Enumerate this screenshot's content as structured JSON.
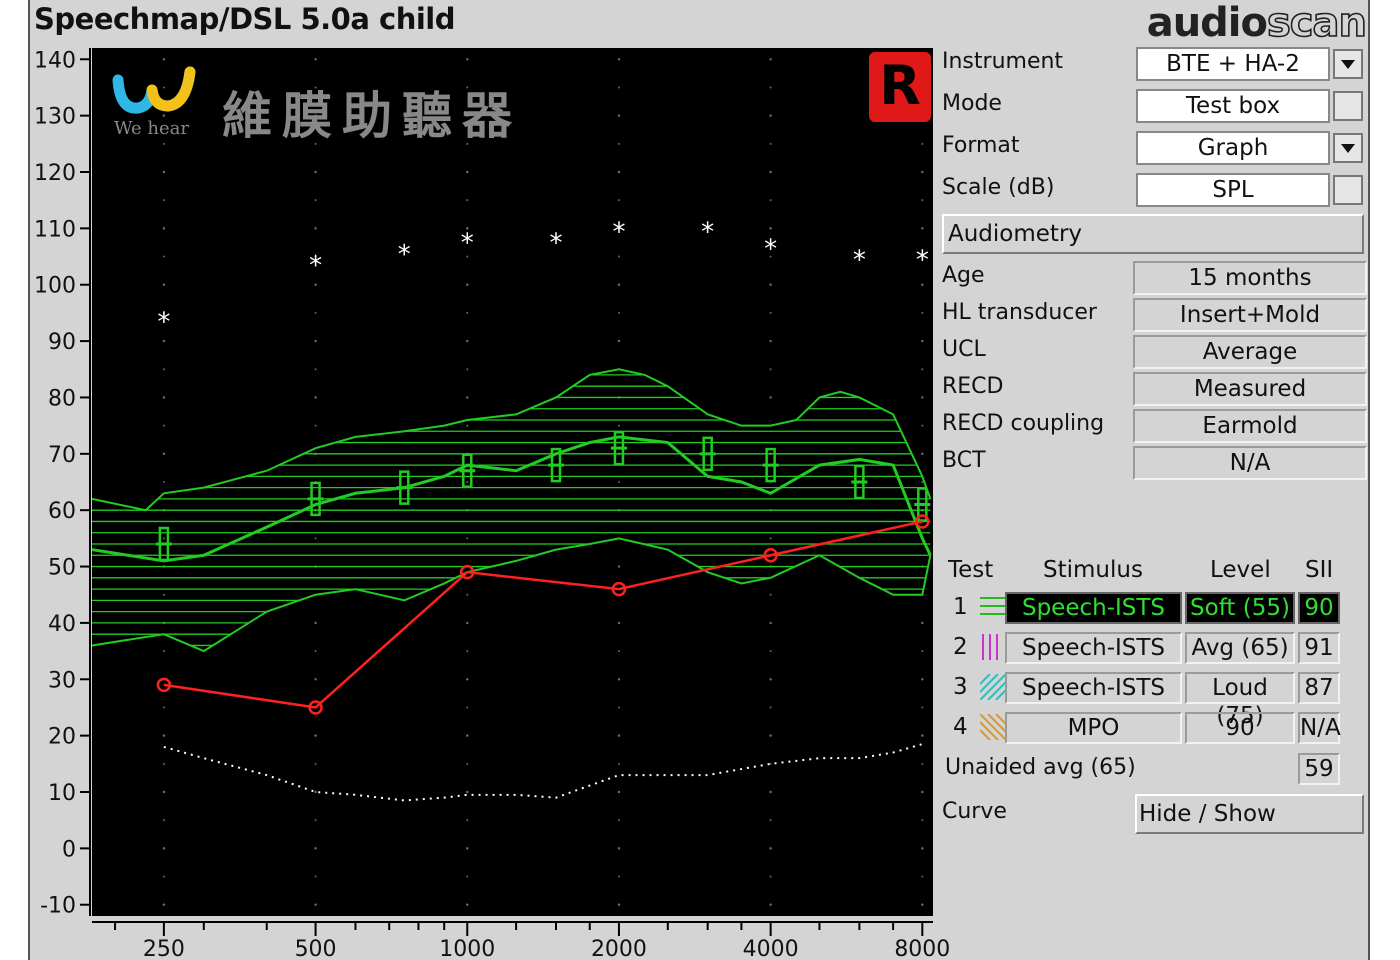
{
  "app": {
    "title": "Speechmap/DSL 5.0a child",
    "brand_left": "audio",
    "brand_right": "scan"
  },
  "ear_badge": "R",
  "watermark": {
    "latin": "We hear",
    "chinese": "維膜助聽器"
  },
  "settings": [
    {
      "label": "Instrument",
      "value": "BTE + HA-2",
      "control": "dropdown"
    },
    {
      "label": "Mode",
      "value": "Test box",
      "control": "checkbox"
    },
    {
      "label": "Format",
      "value": "Graph",
      "control": "dropdown"
    },
    {
      "label": "Scale (dB)",
      "value": "SPL",
      "control": "checkbox"
    }
  ],
  "audiometry_button": "Audiometry",
  "audiometry": [
    {
      "label": "Age",
      "value": "15 months"
    },
    {
      "label": "HL transducer",
      "value": "Insert+Mold"
    },
    {
      "label": "UCL",
      "value": "Average"
    },
    {
      "label": "RECD",
      "value": "Measured"
    },
    {
      "label": "RECD coupling",
      "value": "Earmold"
    },
    {
      "label": "BCT",
      "value": "N/A"
    }
  ],
  "tests_table": {
    "headers": {
      "test": "Test",
      "stimulus": "Stimulus",
      "level": "Level",
      "sii": "SII"
    },
    "rows": [
      {
        "num": "1",
        "stimulus": "Speech-ISTS",
        "level": "Soft (55)",
        "sii": "90",
        "swatch_color": "#22bb22",
        "swatch": "horizontal-lines",
        "active": true
      },
      {
        "num": "2",
        "stimulus": "Speech-ISTS",
        "level": "Avg (65)",
        "sii": "91",
        "swatch_color": "#cc33cc",
        "swatch": "vertical-lines",
        "active": false
      },
      {
        "num": "3",
        "stimulus": "Speech-ISTS",
        "level": "Loud (75)",
        "sii": "87",
        "swatch_color": "#33bbbb",
        "swatch": "diagonal-lines",
        "active": false
      },
      {
        "num": "4",
        "stimulus": "MPO",
        "level": "90",
        "sii": "N/A",
        "swatch_color": "#dd9922",
        "swatch": "diagonal-lines",
        "active": false
      }
    ],
    "unaided": {
      "label": "Unaided avg (65)",
      "value": "59"
    }
  },
  "curve": {
    "label": "Curve",
    "button": "Hide / Show"
  },
  "chart_data": {
    "type": "line",
    "title": "",
    "xlabel": "",
    "ylabel": "",
    "x_scale": "log",
    "xlim": [
      180,
      8400
    ],
    "ylim": [
      -12,
      142
    ],
    "x_ticks": [
      250,
      500,
      1000,
      2000,
      4000,
      8000
    ],
    "y_ticks": [
      140,
      130,
      120,
      110,
      100,
      90,
      80,
      70,
      60,
      50,
      40,
      30,
      20,
      10,
      0,
      -10
    ],
    "grid": "dotted",
    "series": [
      {
        "style": "ucl-asterisks",
        "color": "#ffffff",
        "x": [
          250,
          500,
          750,
          1000,
          1500,
          2000,
          3000,
          4000,
          6000,
          8000
        ],
        "y": [
          94,
          104,
          106,
          108,
          108,
          110,
          110,
          107,
          105,
          105
        ]
      },
      {
        "style": "threshold-circles",
        "color": "#ff2020",
        "x": [
          250,
          500,
          1000,
          2000,
          4000,
          8000
        ],
        "y": [
          29,
          25,
          49,
          46,
          52,
          58
        ]
      },
      {
        "style": "speech-ltass",
        "color": "#22cc22",
        "x": [
          180,
          250,
          300,
          400,
          500,
          600,
          750,
          900,
          1000,
          1250,
          1500,
          1750,
          2000,
          2500,
          3000,
          3500,
          4000,
          5000,
          6000,
          7000,
          8000,
          8300
        ],
        "y": [
          53,
          51,
          52,
          57,
          61,
          63,
          64,
          66,
          68,
          67,
          70,
          72,
          73,
          72,
          66,
          65,
          63,
          68,
          69,
          68,
          55,
          52
        ]
      },
      {
        "style": "speech-band-upper",
        "color": "#22cc22",
        "x": [
          180,
          230,
          250,
          300,
          400,
          500,
          600,
          750,
          900,
          1000,
          1250,
          1500,
          1750,
          2000,
          2250,
          2500,
          3000,
          3500,
          4000,
          4500,
          5000,
          5500,
          6000,
          7000,
          8000,
          8300
        ],
        "y": [
          62,
          60,
          63,
          64,
          67,
          71,
          73,
          74,
          75,
          76,
          77,
          80,
          84,
          85,
          84,
          82,
          77,
          75,
          75,
          76,
          80,
          81,
          80,
          77,
          66,
          62
        ]
      },
      {
        "style": "speech-band-lower",
        "color": "#22cc22",
        "x": [
          180,
          250,
          300,
          400,
          500,
          600,
          750,
          900,
          1000,
          1250,
          1500,
          1750,
          2000,
          2500,
          3000,
          3500,
          4000,
          5000,
          6000,
          7000,
          8000,
          8300
        ],
        "y": [
          36,
          38,
          35,
          42,
          45,
          46,
          44,
          47,
          49,
          51,
          53,
          54,
          55,
          53,
          49,
          47,
          48,
          52,
          48,
          45,
          45,
          52
        ]
      },
      {
        "style": "speech-peak-markers",
        "color": "#22cc22",
        "x": [
          250,
          500,
          750,
          1000,
          1500,
          2000,
          3000,
          4000,
          6000,
          8000
        ],
        "y": [
          54,
          62,
          64,
          67,
          68,
          71,
          70,
          68,
          65,
          61
        ]
      },
      {
        "style": "normal-hearing-dotted",
        "color": "#ffffff",
        "x": [
          250,
          300,
          400,
          500,
          600,
          750,
          900,
          1000,
          1250,
          1500,
          2000,
          2500,
          3000,
          4000,
          5000,
          6000,
          7000,
          8000
        ],
        "y": [
          18,
          16,
          13,
          10,
          9.5,
          8.5,
          9,
          9.5,
          9.5,
          9,
          13,
          13,
          13,
          15,
          16,
          16,
          17,
          18.5
        ]
      }
    ]
  }
}
